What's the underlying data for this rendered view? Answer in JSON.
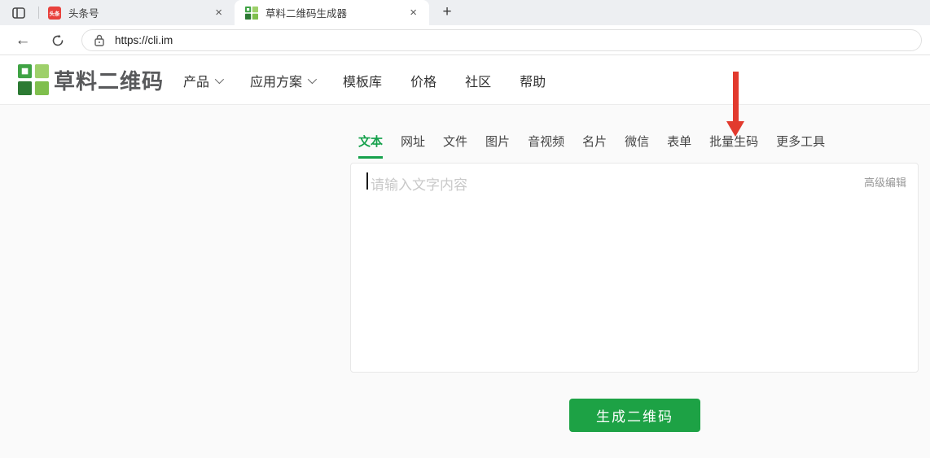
{
  "browser": {
    "tabs": [
      {
        "title": "头条号",
        "favicon": "toutiao-icon",
        "favicon_text": "头条",
        "close_glyph": "×"
      },
      {
        "title": "草料二维码生成器",
        "favicon": "qr-logo-icon",
        "close_glyph": "×",
        "active": true
      }
    ],
    "new_tab_glyph": "+",
    "back_glyph": "←",
    "address": {
      "url": "https://cli.im"
    }
  },
  "header": {
    "brand": "草料二维码",
    "nav": [
      {
        "label": "产品",
        "has_dropdown": true
      },
      {
        "label": "应用方案",
        "has_dropdown": true
      },
      {
        "label": "模板库",
        "has_dropdown": false
      },
      {
        "label": "价格",
        "has_dropdown": false
      },
      {
        "label": "社区",
        "has_dropdown": false
      },
      {
        "label": "帮助",
        "has_dropdown": false
      }
    ]
  },
  "generator": {
    "tabs": [
      {
        "label": "文本",
        "active": true
      },
      {
        "label": "网址"
      },
      {
        "label": "文件"
      },
      {
        "label": "图片"
      },
      {
        "label": "音视频"
      },
      {
        "label": "名片"
      },
      {
        "label": "微信"
      },
      {
        "label": "表单"
      },
      {
        "label": "批量生码"
      },
      {
        "label": "更多工具"
      }
    ],
    "editor": {
      "value": "",
      "placeholder": "请输入文字内容",
      "advanced_edit_label": "高级编辑"
    },
    "generate_button_label": "生成二维码"
  },
  "annotation": {
    "type": "arrow-down",
    "color": "#e23a2e",
    "points_to": "批量生码"
  },
  "colors": {
    "brand_green": "#16a14c",
    "button_green": "#1da245",
    "logo_green_dark": "#2c7a33",
    "logo_green_mid": "#3fa344",
    "logo_green_light": "#9ed06a",
    "tabstrip_bg": "#edeff2"
  }
}
